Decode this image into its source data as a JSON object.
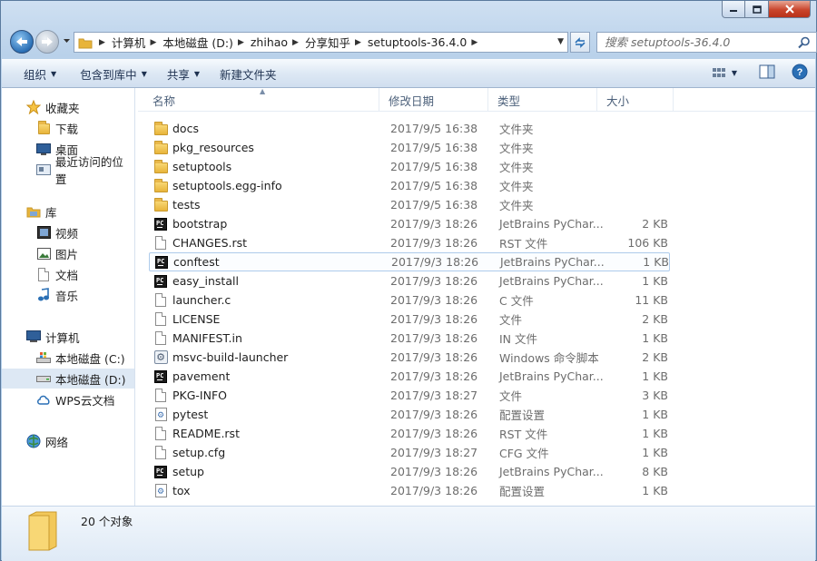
{
  "window": {
    "caption_buttons": [
      "minimize",
      "maximize",
      "close"
    ]
  },
  "address": {
    "breadcrumbs": [
      "计算机",
      "本地磁盘 (D:)",
      "zhihao",
      "分享知乎",
      "setuptools-36.4.0"
    ]
  },
  "search": {
    "placeholder": "搜索 setuptools-36.4.0"
  },
  "toolbar": {
    "organize": "组织",
    "include_in_library": "包含到库中",
    "share": "共享",
    "new_folder": "新建文件夹"
  },
  "sidebar": {
    "favorites": {
      "label": "收藏夹",
      "items": [
        "下载",
        "桌面",
        "最近访问的位置"
      ]
    },
    "libraries": {
      "label": "库",
      "items": [
        "视频",
        "图片",
        "文档",
        "音乐"
      ]
    },
    "computer": {
      "label": "计算机",
      "items": [
        "本地磁盘 (C:)",
        "本地磁盘 (D:)",
        "WPS云文档"
      ]
    },
    "network": {
      "label": "网络"
    }
  },
  "columns": {
    "name": "名称",
    "date": "修改日期",
    "type": "类型",
    "size": "大小"
  },
  "files": [
    {
      "name": "docs",
      "date": "2017/9/5 16:38",
      "type": "文件夹",
      "size": "",
      "icon": "folder-icon"
    },
    {
      "name": "pkg_resources",
      "date": "2017/9/5 16:38",
      "type": "文件夹",
      "size": "",
      "icon": "folder-icon"
    },
    {
      "name": "setuptools",
      "date": "2017/9/5 16:38",
      "type": "文件夹",
      "size": "",
      "icon": "folder-icon"
    },
    {
      "name": "setuptools.egg-info",
      "date": "2017/9/5 16:38",
      "type": "文件夹",
      "size": "",
      "icon": "folder-icon"
    },
    {
      "name": "tests",
      "date": "2017/9/5 16:38",
      "type": "文件夹",
      "size": "",
      "icon": "folder-icon"
    },
    {
      "name": "bootstrap",
      "date": "2017/9/3 18:26",
      "type": "JetBrains PyChar...",
      "size": "2 KB",
      "icon": "pycharm-icon"
    },
    {
      "name": "CHANGES.rst",
      "date": "2017/9/3 18:26",
      "type": "RST 文件",
      "size": "106 KB",
      "icon": "document-icon"
    },
    {
      "name": "conftest",
      "date": "2017/9/3 18:26",
      "type": "JetBrains PyChar...",
      "size": "1 KB",
      "icon": "pycharm-icon"
    },
    {
      "name": "easy_install",
      "date": "2017/9/3 18:26",
      "type": "JetBrains PyChar...",
      "size": "1 KB",
      "icon": "pycharm-icon"
    },
    {
      "name": "launcher.c",
      "date": "2017/9/3 18:26",
      "type": "C 文件",
      "size": "11 KB",
      "icon": "document-icon"
    },
    {
      "name": "LICENSE",
      "date": "2017/9/3 18:26",
      "type": "文件",
      "size": "2 KB",
      "icon": "document-icon"
    },
    {
      "name": "MANIFEST.in",
      "date": "2017/9/3 18:26",
      "type": "IN 文件",
      "size": "1 KB",
      "icon": "document-icon"
    },
    {
      "name": "msvc-build-launcher",
      "date": "2017/9/3 18:26",
      "type": "Windows 命令脚本",
      "size": "2 KB",
      "icon": "gear-icon"
    },
    {
      "name": "pavement",
      "date": "2017/9/3 18:26",
      "type": "JetBrains PyChar...",
      "size": "1 KB",
      "icon": "pycharm-icon"
    },
    {
      "name": "PKG-INFO",
      "date": "2017/9/3 18:27",
      "type": "文件",
      "size": "3 KB",
      "icon": "document-icon"
    },
    {
      "name": "pytest",
      "date": "2017/9/3 18:26",
      "type": "配置设置",
      "size": "1 KB",
      "icon": "config-icon"
    },
    {
      "name": "README.rst",
      "date": "2017/9/3 18:26",
      "type": "RST 文件",
      "size": "1 KB",
      "icon": "document-icon"
    },
    {
      "name": "setup.cfg",
      "date": "2017/9/3 18:27",
      "type": "CFG 文件",
      "size": "1 KB",
      "icon": "document-icon"
    },
    {
      "name": "setup",
      "date": "2017/9/3 18:26",
      "type": "JetBrains PyChar...",
      "size": "8 KB",
      "icon": "pycharm-icon"
    },
    {
      "name": "tox",
      "date": "2017/9/3 18:26",
      "type": "配置设置",
      "size": "1 KB",
      "icon": "config-icon"
    }
  ],
  "hovered_file": "conftest",
  "status": {
    "item_count": "20 个对象"
  },
  "colors": {
    "accent": "#2a6fb5",
    "folder": "#e8b43a",
    "row_hover": "#aecbeb"
  }
}
